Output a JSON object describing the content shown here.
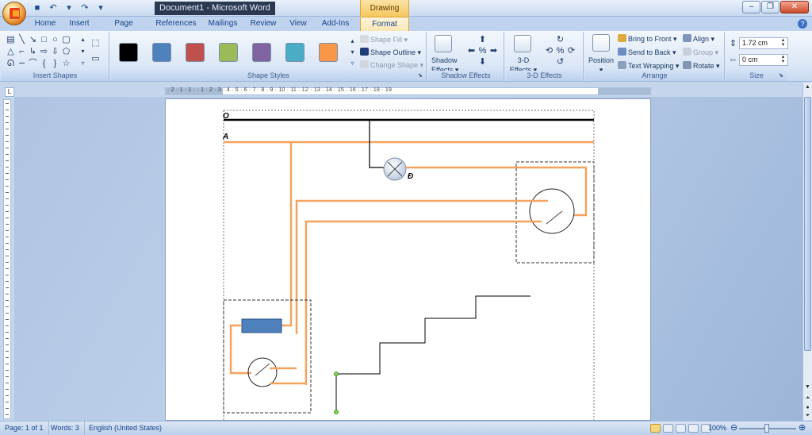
{
  "window": {
    "doc_name": "Document1",
    "app_name": "Microsoft Word",
    "contextual_tab": "Drawing Tools"
  },
  "quick_access": {
    "undo_icon": "undo-icon",
    "redo_icon": "redo-icon",
    "save_icon": "save-icon"
  },
  "tabs": [
    {
      "label": "Home"
    },
    {
      "label": "Insert"
    },
    {
      "label": "Page Layout"
    },
    {
      "label": "References"
    },
    {
      "label": "Mailings"
    },
    {
      "label": "Review"
    },
    {
      "label": "View"
    },
    {
      "label": "Add-Ins"
    },
    {
      "label": "Format"
    }
  ],
  "ribbon": {
    "insert_shapes": {
      "label": "Insert Shapes"
    },
    "shape_styles": {
      "label": "Shape Styles",
      "swatches": [
        "#000000",
        "#4f81bd",
        "#c0504d",
        "#9bbb59",
        "#8064a2",
        "#4bacc6",
        "#f79646"
      ],
      "shape_fill": "Shape Fill",
      "shape_outline": "Shape Outline",
      "change_shape": "Change Shape"
    },
    "shadow_effects": {
      "label": "Shadow Effects",
      "button_line1": "Shadow",
      "button_line2": "Effects"
    },
    "effects_3d": {
      "label": "3-D Effects",
      "button_line1": "3-D",
      "button_line2": "Effects"
    },
    "arrange": {
      "label": "Arrange",
      "position": "Position",
      "bring_to_front": "Bring to Front",
      "send_to_back": "Send to Back",
      "text_wrapping": "Text Wrapping",
      "align": "Align",
      "group": "Group",
      "rotate": "Rotate"
    },
    "size": {
      "label": "Size",
      "height": "1.72 cm",
      "width": "0 cm"
    }
  },
  "ruler": {
    "text": "· 2 · 1 · 1 · · 1 · 2 · 3 · 4 · 5 · 6 · 7 · 8 · 9 · 10 · 11 · 12 · 13 · 14 · 15 · 16 · 17 · 18 · 19"
  },
  "diagram": {
    "label_o": "O",
    "label_a": "A",
    "label_d": "Đ",
    "wire_color": "#f3a35f",
    "fuse_color": "#4f81bd"
  },
  "status": {
    "page": "Page: 1 of 1",
    "words": "Words: 3",
    "language": "English (United States)",
    "zoom": "100%"
  }
}
